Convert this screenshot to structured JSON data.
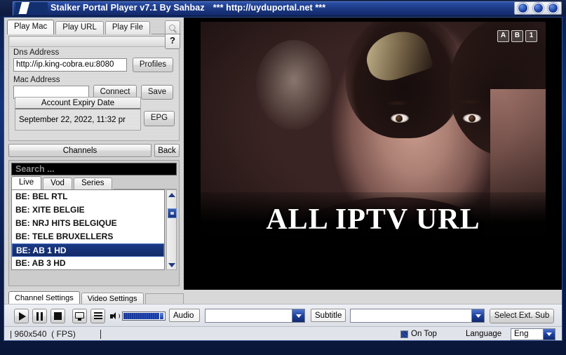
{
  "window": {
    "title": "Stalker Portal Player v7.1 By Sahbaz",
    "subtitle": "*** http://uyduportal.net ***",
    "buttons": [
      "minimize-dot",
      "maximize-dot",
      "close-dot"
    ]
  },
  "left_panel": {
    "tabs": [
      {
        "label": "Play Mac",
        "active": true
      },
      {
        "label": "Play URL",
        "active": false
      },
      {
        "label": "Play File",
        "active": false
      }
    ],
    "magnifier_icon": "search-icon",
    "help_button": "?",
    "dns": {
      "label": "Dns Address",
      "value": "http://ip.king-cobra.eu:8080",
      "profiles_button": "Profiles"
    },
    "mac": {
      "label": "Mac Address",
      "value": "",
      "connect_button": "Connect",
      "save_button": "Save"
    },
    "expiry": {
      "header": "Account Expiry Date",
      "value": "September 22, 2022, 11:32 pr",
      "epg_button": "EPG"
    },
    "channels_button": "Channels",
    "back_button": "Back",
    "search_placeholder": "Search ...",
    "sub_tabs": [
      {
        "label": "Live",
        "active": true
      },
      {
        "label": "Vod",
        "active": false
      },
      {
        "label": "Series",
        "active": false
      }
    ],
    "channel_list": [
      {
        "label": "BE: BEL RTL",
        "selected": false
      },
      {
        "label": "BE: XITE BELGIE",
        "selected": false
      },
      {
        "label": "BE: NRJ HITS BELGIQUE",
        "selected": false
      },
      {
        "label": "BE: TELE BRUXELLERS",
        "selected": false
      },
      {
        "label": "BE: AB 1 HD",
        "selected": true
      },
      {
        "label": "BE: AB 3 HD",
        "selected": false
      }
    ],
    "bottom_tabs": [
      {
        "label": "Channel Settings",
        "active": true
      },
      {
        "label": "Video Settings",
        "active": false
      }
    ]
  },
  "video": {
    "overlay_badges": [
      "A",
      "B",
      "1"
    ],
    "watermark": "ALL IPTV URL"
  },
  "controls": {
    "play_icon": "play-icon",
    "pause_icon": "pause-icon",
    "stop_icon": "stop-icon",
    "screen_icon": "screen-icon",
    "playlist_icon": "playlist-icon",
    "speaker_icon": "speaker-icon",
    "volume_percent": 96,
    "audio_label": "Audio",
    "audio_value": "",
    "subtitle_label": "Subtitle",
    "subtitle_value": "",
    "select_ext_sub_button": "Select Ext. Sub"
  },
  "status": {
    "resolution_fps": "| 960x540  ( FPS)",
    "on_top_label": "On Top",
    "on_top_checked": true,
    "language_label": "Language",
    "language_value": "Eng"
  },
  "colors": {
    "title_blue": "#1d3b86",
    "accent_blue": "#17357f",
    "selection_blue": "#1b3a85"
  }
}
